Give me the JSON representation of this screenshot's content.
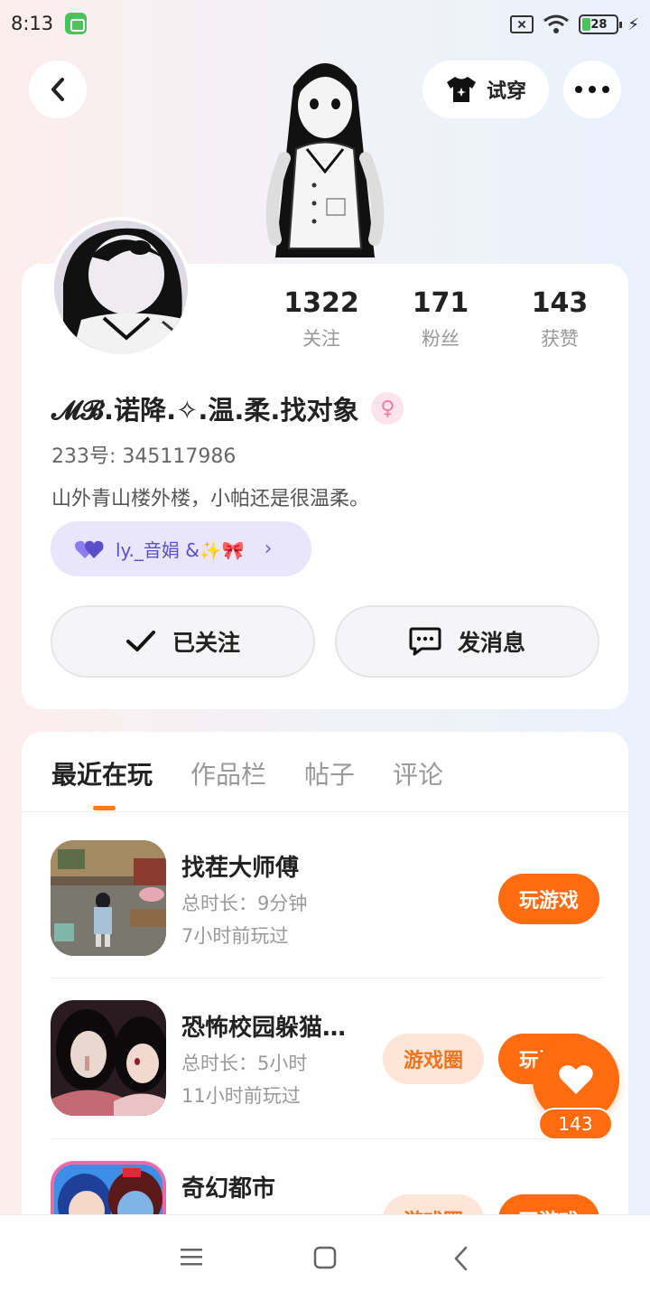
{
  "status_bar": {
    "time": "8:13",
    "battery": "28"
  },
  "header": {
    "try_on_label": "试穿"
  },
  "profile": {
    "stats": [
      {
        "value": "1322",
        "label": "关注"
      },
      {
        "value": "171",
        "label": "粉丝"
      },
      {
        "value": "143",
        "label": "获赞"
      }
    ],
    "username": "𝓜𝓑.诺降.✧.温.柔.找对象",
    "uid": "233号: 345117986",
    "bio": "山外青山楼外楼，小帕还是很温柔。",
    "cp_tag": "ly._音娟 &✨🎀",
    "follow_label": "已关注",
    "message_label": "发消息"
  },
  "tabs": [
    "最近在玩",
    "作品栏",
    "帖子",
    "评论"
  ],
  "games": [
    {
      "title": "找茬大师傅",
      "duration": "总时长：9分钟",
      "last_played": "7小时前玩过",
      "play_label": "玩游戏"
    },
    {
      "title": "恐怖校园躲猫…",
      "duration": "总时长：5小时",
      "last_played": "11小时前玩过",
      "circle_label": "游戏圈",
      "play_label": "玩游戏"
    },
    {
      "title": "奇幻都市",
      "circle_label": "游戏圈",
      "play_label": "玩游戏"
    }
  ],
  "like_count": "143",
  "colors": {
    "accent": "#ff6b0f",
    "tag_bg": "#e9e6fb",
    "tag_text": "#5a4fc8"
  }
}
